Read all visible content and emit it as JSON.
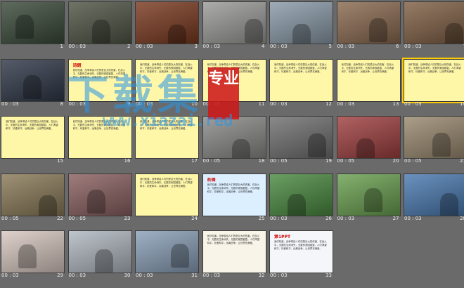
{
  "slides": [
    {
      "n": "1",
      "time": "",
      "bg": "#3a4a3a",
      "style": "photo"
    },
    {
      "n": "2",
      "time": "00 : 03",
      "bg": "#505545",
      "style": "photo"
    },
    {
      "n": "3",
      "time": "00 : 03",
      "bg": "#7a3a20",
      "style": "photo"
    },
    {
      "n": "4",
      "time": "00 : 03",
      "bg": "#9a9a98",
      "style": "photo"
    },
    {
      "n": "5",
      "time": "00 : 03",
      "bg": "#8a9aa8",
      "style": "photo"
    },
    {
      "n": "6",
      "time": "00 : 03",
      "bg": "#8a6a50",
      "style": "photo"
    },
    {
      "n": "7",
      "time": "00 : 03",
      "bg": "#806045",
      "style": "photo"
    },
    {
      "n": "8",
      "time": "00 : 03",
      "bg": "#303848",
      "style": "photo"
    },
    {
      "n": "9",
      "time": "00 : 03",
      "bg": "#fff7a8",
      "style": "text"
    },
    {
      "n": "10",
      "time": "00 : 03",
      "bg": "#fff7a8",
      "style": "text"
    },
    {
      "n": "11",
      "time": "00 : 03",
      "bg": "#fff7a8",
      "style": "text"
    },
    {
      "n": "12",
      "time": "00 : 03",
      "bg": "#fff7a8",
      "style": "text"
    },
    {
      "n": "13",
      "time": "00 : 03",
      "bg": "#fff7a8",
      "style": "text"
    },
    {
      "n": "14",
      "time": "00 : 03",
      "bg": "#fff7a8",
      "style": "text"
    },
    {
      "n": "15",
      "time": "",
      "bg": "#fff7a8",
      "style": "text"
    },
    {
      "n": "16",
      "time": "",
      "bg": "#fff7a8",
      "style": "text"
    },
    {
      "n": "17",
      "time": "",
      "bg": "#fff7a8",
      "style": "text"
    },
    {
      "n": "18",
      "time": "00 : 05",
      "bg": "#8a8a88",
      "style": "photo"
    },
    {
      "n": "19",
      "time": "00 : 05",
      "bg": "#707070",
      "style": "photo"
    },
    {
      "n": "20",
      "time": "00 : 05",
      "bg": "#a04040",
      "style": "photo"
    },
    {
      "n": "21",
      "time": "00 : 05",
      "bg": "#9a8a70",
      "style": "photo"
    },
    {
      "n": "22",
      "time": "00 : 05",
      "bg": "#8a7a58",
      "style": "photo"
    },
    {
      "n": "23",
      "time": "00 : 05",
      "bg": "#8a6060",
      "style": "photo"
    },
    {
      "n": "24",
      "time": "",
      "bg": "#fff7a8",
      "style": "text"
    },
    {
      "n": "25",
      "time": "",
      "bg": "#dcefff",
      "style": "text"
    },
    {
      "n": "26",
      "time": "00 : 03",
      "bg": "#4a8a40",
      "style": "photo"
    },
    {
      "n": "27",
      "time": "00 : 03",
      "bg": "#6aa050",
      "style": "photo"
    },
    {
      "n": "28",
      "time": "00 : 03",
      "bg": "#4a7ab0",
      "style": "photo"
    },
    {
      "n": "29",
      "time": "00 : 03",
      "bg": "#d8c8c0",
      "style": "photo"
    },
    {
      "n": "30",
      "time": "00 : 03",
      "bg": "#b0b8c0",
      "style": "photo"
    },
    {
      "n": "31",
      "time": "00 : 03",
      "bg": "#8aa0b8",
      "style": "photo"
    },
    {
      "n": "32",
      "time": "00 : 03",
      "bg": "#f8f4e8",
      "style": "text"
    },
    {
      "n": "33",
      "time": "00 : 03",
      "bg": "#f4f6fa",
      "style": "text"
    }
  ],
  "slide_texts": {
    "text": "我们知道，战争带给人们的是巨大的伤害，在战火中，无数的生命消失，无数的家园被毁，人们渴望和平，珍爱和平，远离战争，让世界充满爱。",
    "title9": "诗朗",
    "title25": "祈祷",
    "ppt": "第1PPT"
  },
  "watermark": {
    "chars": "下载集",
    "seal": "专业",
    "url": "www.xiazai.red"
  },
  "selected_slide": "14"
}
